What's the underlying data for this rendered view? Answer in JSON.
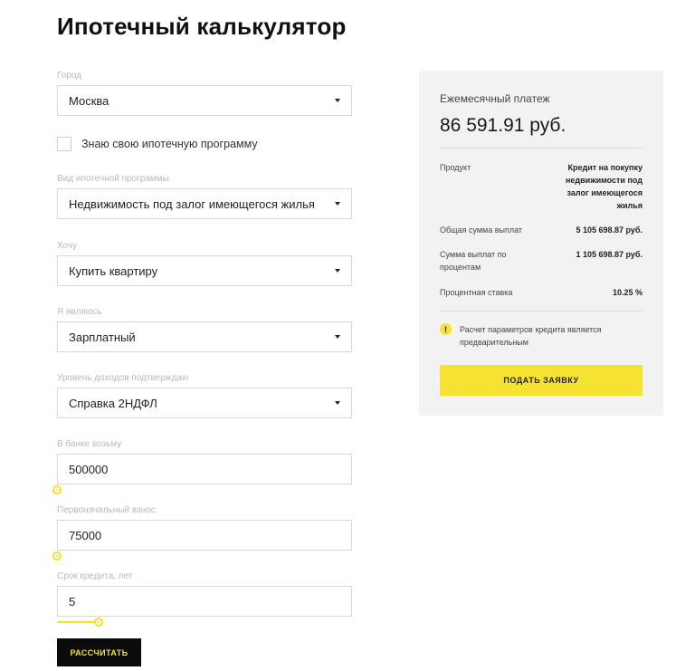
{
  "page": {
    "title": "Ипотечный калькулятор"
  },
  "form": {
    "city": {
      "label": "Город",
      "value": "Москва"
    },
    "known_program": {
      "label": "Знаю свою ипотечную программу",
      "checked": false
    },
    "program_type": {
      "label": "Вид ипотечной программы",
      "value": "Недвижимость под залог имеющегося жилья"
    },
    "want": {
      "label": "Хочу",
      "value": "Купить квартиру"
    },
    "i_am": {
      "label": "Я являюсь",
      "value": "Зарплатный"
    },
    "income": {
      "label": "Уровень доходов подтверждаю",
      "value": "Справка 2НДФЛ"
    },
    "loan_amount": {
      "label": "В банке возьму",
      "value": "500000",
      "slider_fraction": 0
    },
    "down_payment": {
      "label": "Первоначальный взнос",
      "value": "75000",
      "slider_fraction": 0
    },
    "term": {
      "label": "Срок кредита, лет",
      "value": "5",
      "slider_fraction": 0.14
    },
    "calculate_label": "РАССЧИТАТЬ"
  },
  "summary": {
    "monthly_label": "Ежемесячный платеж",
    "monthly_value": "86 591.91 руб.",
    "product_label": "Продукт",
    "product_value": "Кредит на покупку недвижимости под залог имеющегося жилья",
    "total_label": "Общая сумма выплат",
    "total_value": "5 105 698.87 руб.",
    "interest_sum_label": "Сумма выплат по процентам",
    "interest_sum_value": "1 105 698.87 руб.",
    "rate_label": "Процентная ставка",
    "rate_value": "10.25 %",
    "note_icon": "!",
    "note": "Расчет параметров кредита является предварительным",
    "apply_label": "ПОДАТЬ ЗАЯВКУ"
  },
  "colors": {
    "accent": "#f6e331",
    "dark": "#0b0b0b",
    "panel_bg": "#f2f2f2"
  }
}
